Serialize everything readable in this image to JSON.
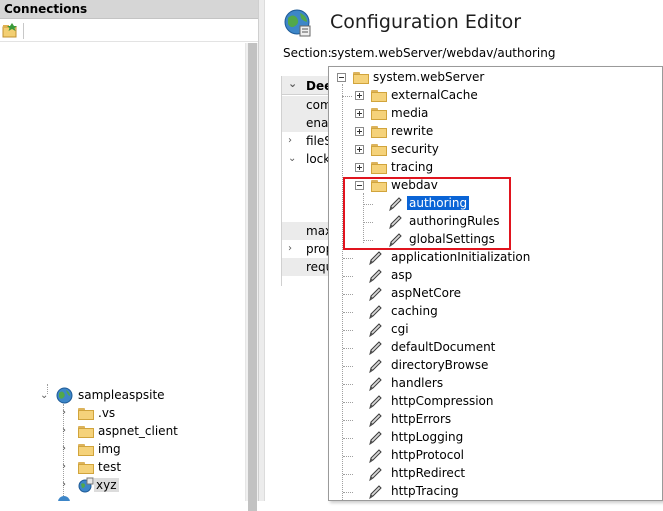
{
  "connections": {
    "title": "Connections",
    "tree": [
      {
        "label": "sampleaspsite",
        "icon": "globe-icon",
        "expanded": true
      },
      {
        "label": ".vs",
        "icon": "folder-icon"
      },
      {
        "label": "aspnet_client",
        "icon": "folder-icon"
      },
      {
        "label": "img",
        "icon": "folder-icon"
      },
      {
        "label": "test",
        "icon": "folder-icon"
      },
      {
        "label": "xyz",
        "icon": "app-icon",
        "selected": true
      }
    ]
  },
  "header": {
    "title": "Configuration Editor",
    "section_label": "Section:",
    "section_value": "system.webServer/webdav/authoring"
  },
  "grid": {
    "header": "Dee",
    "rows": [
      "com",
      "enab",
      "fileS",
      "lock",
      "",
      "",
      "",
      "max",
      "propi",
      "requ"
    ]
  },
  "dropdown": {
    "root": "system.webServer",
    "folders_before": [
      "externalCache",
      "media",
      "rewrite",
      "security",
      "tracing"
    ],
    "webdav": {
      "label": "webdav",
      "children": [
        "authoring",
        "authoringRules",
        "globalSettings"
      ],
      "selected": "authoring"
    },
    "sections": [
      "applicationInitialization",
      "asp",
      "aspNetCore",
      "caching",
      "cgi",
      "defaultDocument",
      "directoryBrowse",
      "handlers",
      "httpCompression",
      "httpErrors",
      "httpLogging",
      "httpProtocol",
      "httpRedirect",
      "httpTracing"
    ]
  },
  "colors": {
    "selection": "#0a64d6",
    "highlight_box": "#e0141e",
    "folder": "#f5d27a"
  }
}
